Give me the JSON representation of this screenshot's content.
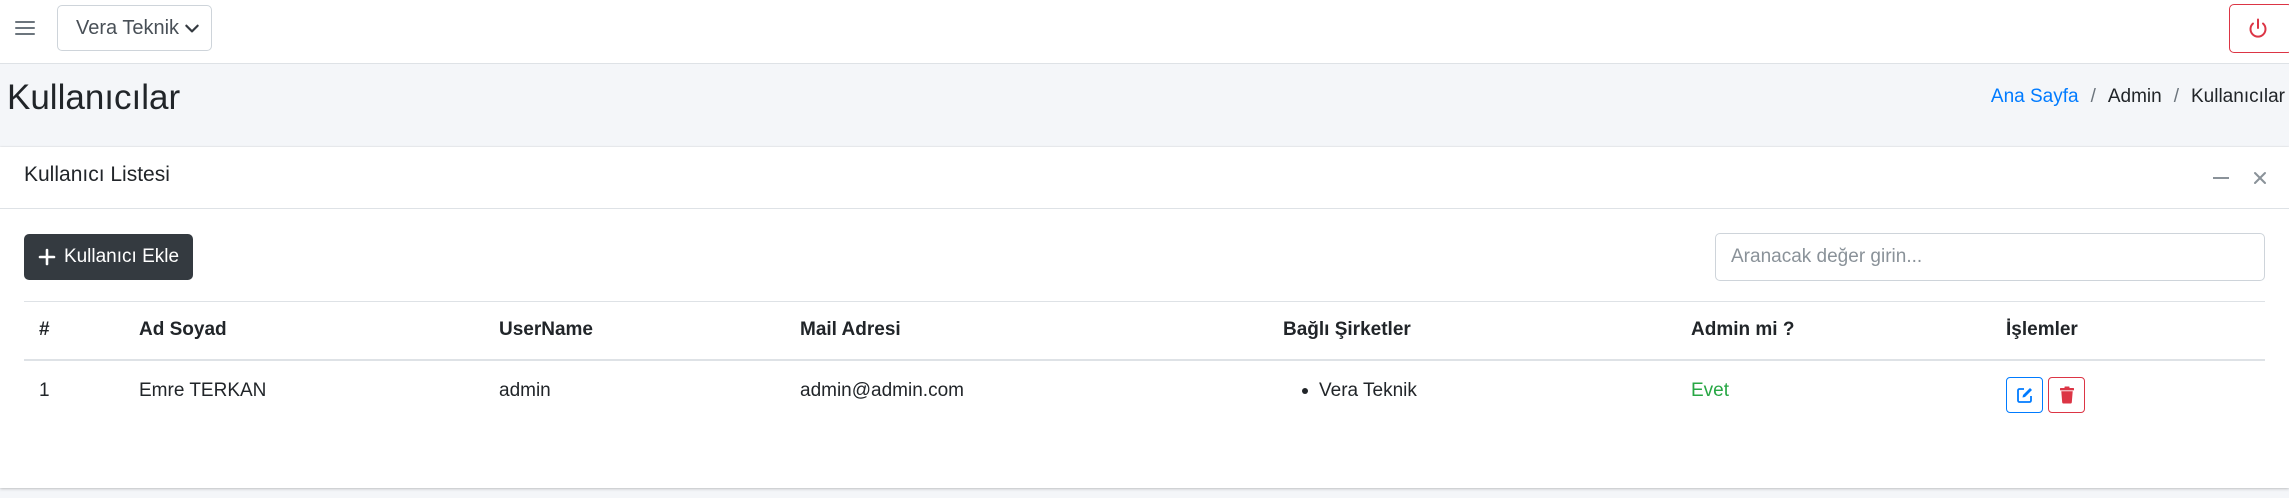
{
  "navbar": {
    "menu_icon": "bars-icon",
    "company_select": {
      "value": "Vera Teknik",
      "icon": "chevron-down-icon"
    },
    "logout_icon": "power-icon",
    "logout_color": "#dc3545"
  },
  "header": {
    "title": "Kullanıcılar",
    "breadcrumb": [
      "Ana Sayfa",
      "Admin",
      "Kullanıcılar"
    ],
    "breadcrumb_separator": "/"
  },
  "card": {
    "title": "Kullanıcı Listesi",
    "tools": [
      "minus-icon",
      "close-icon"
    ],
    "add_button": {
      "label": "Kullanıcı Ekle",
      "icon": "plus-icon"
    },
    "search": {
      "value": "",
      "placeholder": "Aranacak değer girin..."
    },
    "table": {
      "columns": [
        "#",
        "Ad Soyad",
        "UserName",
        "Mail Adresi",
        "Bağlı Şirketler",
        "Admin mi ?",
        "İşlemler"
      ],
      "rows": [
        {
          "no": "1",
          "full_name": "Emre TERKAN",
          "username": "admin",
          "email": "admin@admin.com",
          "companies": [
            "Vera Teknik"
          ],
          "is_admin": "Evet",
          "actions": [
            "edit-icon",
            "trash-icon"
          ]
        }
      ]
    }
  },
  "colors": {
    "primary": "#007bff",
    "danger": "#dc3545",
    "success": "#28a745",
    "dark_button": "#343a40",
    "page_background": "#f4f6f9"
  }
}
